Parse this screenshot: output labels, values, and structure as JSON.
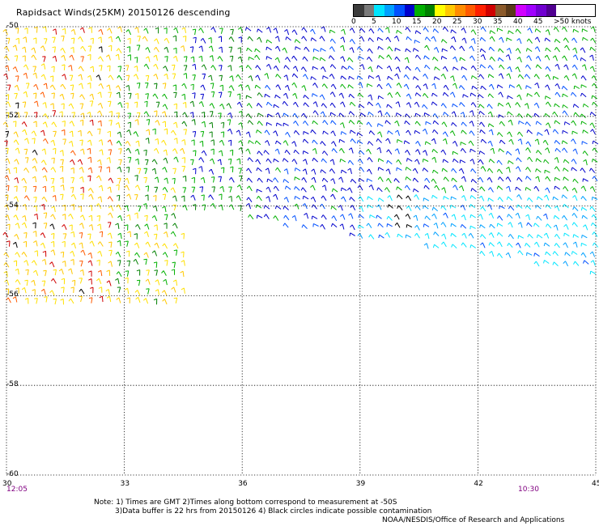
{
  "title": "Rapidsact Winds(25KM) 20150126 descending",
  "legend": {
    "colors": [
      "#3c3c3c",
      "#7a7a7a",
      "#00e5ff",
      "#00a0ff",
      "#0050ff",
      "#0000cc",
      "#00b000",
      "#008000",
      "#ffff00",
      "#ffc800",
      "#ff8c00",
      "#ff5a00",
      "#ff2000",
      "#d00000",
      "#8b5a2b",
      "#5a3a1a",
      "#d000ff",
      "#a000ff",
      "#7000d0",
      "#500090"
    ],
    "labels": [
      "0",
      "5",
      "10",
      "15",
      "20",
      "25",
      "30",
      "35",
      "40",
      "45",
      ">50 knots"
    ]
  },
  "axes": {
    "y_labels": [
      "-50",
      "-52",
      "-54",
      "-56",
      "-58",
      "-60"
    ],
    "x_labels": [
      "30",
      "33",
      "36",
      "39",
      "42",
      "45"
    ],
    "time_start": "12:05",
    "time_end": "10:30"
  },
  "notes": {
    "line1": "Note: 1) Times are GMT 2)Times along bottom correspond to measurement at -50S",
    "line2": "3)Data buffer is 22 hrs from 20150126 4) Black circles indicate possible contamination",
    "credit": "NOAA/NESDIS/Office of Research and Applications"
  },
  "chart_data": {
    "type": "wind-barb-map",
    "title": "Rapidsact Winds(25KM) 20150126 descending",
    "x_label": "",
    "y_label": "",
    "lon_range": [
      30,
      45
    ],
    "lat_range": [
      -60,
      -50
    ],
    "grid": true,
    "units": "knots",
    "legend_placement": "top-right",
    "regions": [
      {
        "lon_range": [
          30,
          33
        ],
        "lat_range": [
          -56.5,
          -50
        ],
        "speed_knots": "20-35",
        "colors": [
          "yellow",
          "orange",
          "red"
        ]
      },
      {
        "lon_range": [
          33,
          36
        ],
        "lat_range": [
          -56.5,
          -50
        ],
        "speed_knots": "15-25",
        "colors": [
          "green",
          "yellow"
        ]
      },
      {
        "lon_range": [
          36,
          39
        ],
        "lat_range": [
          -55,
          -50
        ],
        "speed_knots": "10-15",
        "colors": [
          "blue",
          "green"
        ]
      },
      {
        "lon_range": [
          39,
          45
        ],
        "lat_range": [
          -56,
          -50
        ],
        "speed_knots": "5-15",
        "colors": [
          "cyan",
          "blue",
          "green"
        ]
      }
    ]
  }
}
